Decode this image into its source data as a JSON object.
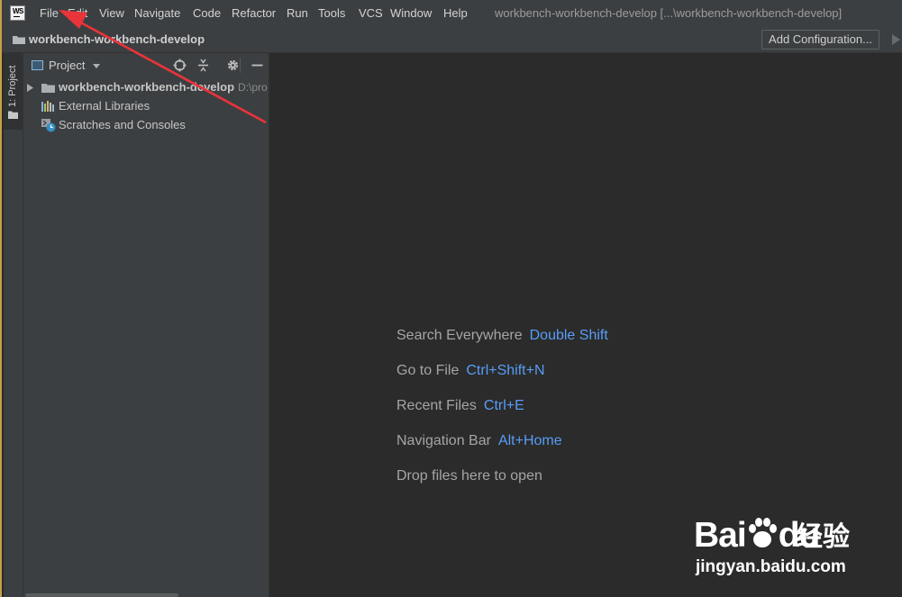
{
  "app": {
    "logo_text": "WS",
    "window_title": "workbench-workbench-develop [...\\workbench-workbench-develop]"
  },
  "menu": [
    "File",
    "Edit",
    "View",
    "Navigate",
    "Code",
    "Refactor",
    "Run",
    "Tools",
    "VCS",
    "Window",
    "Help"
  ],
  "navbar": {
    "project_name": "workbench-workbench-develop",
    "add_configuration_label": "Add Configuration..."
  },
  "tool_stripe": {
    "project_tab_label": "1: Project"
  },
  "project_panel": {
    "title": "Project",
    "tree": [
      {
        "label": "workbench-workbench-develop",
        "path": "D:\\pro",
        "icon": "folder-icon"
      },
      {
        "label": "External Libraries",
        "icon": "libraries-icon"
      },
      {
        "label": "Scratches and Consoles",
        "icon": "scratches-icon"
      }
    ]
  },
  "editor": {
    "hints": [
      {
        "label": "Search Everywhere",
        "shortcut": "Double Shift"
      },
      {
        "label": "Go to File",
        "shortcut": "Ctrl+Shift+N"
      },
      {
        "label": "Recent Files",
        "shortcut": "Ctrl+E"
      },
      {
        "label": "Navigation Bar",
        "shortcut": "Alt+Home"
      },
      {
        "label": "Drop files here to open",
        "shortcut": ""
      }
    ]
  },
  "watermark": {
    "brand": "Bai",
    "brand_suffix": "du",
    "cn_text": "经验",
    "url": "jingyan.baidu.com"
  },
  "colors": {
    "accent_link": "#589df6",
    "annotation_arrow": "#e8343a",
    "window_border": "#c7a047"
  }
}
